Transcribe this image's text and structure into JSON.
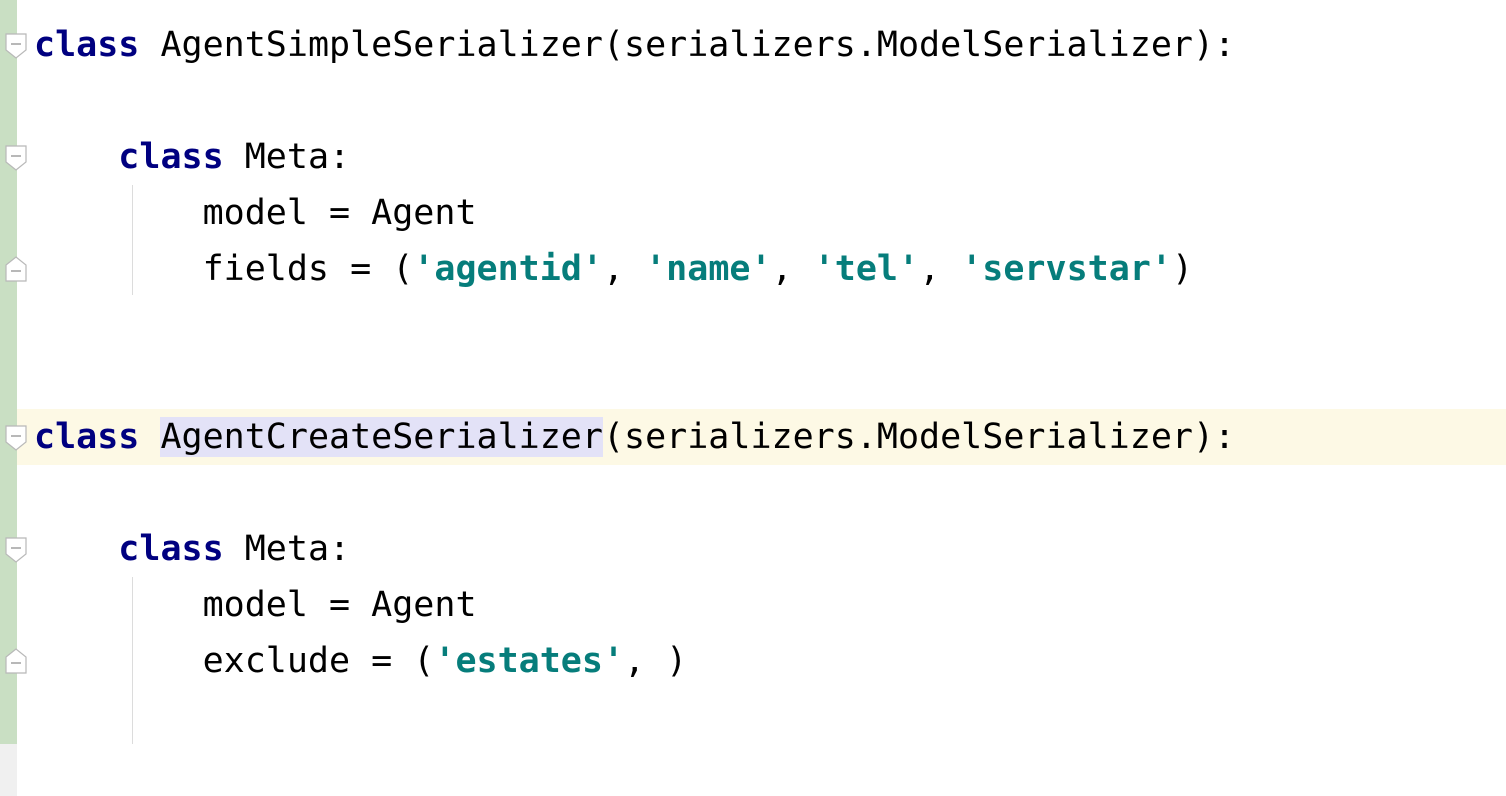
{
  "editor": {
    "colors": {
      "keyword": "#000080",
      "string": "#067d7b",
      "identifier_highlight": "#e3e2f7",
      "current_line": "#fdf9e5",
      "gutter_vcs_added": "#c9dfc3"
    },
    "lines": {
      "l1": {
        "kw": "class",
        "name": "AgentSimpleSerializer",
        "rest": "(serializers.ModelSerializer):"
      },
      "l2": {
        "kw": "class",
        "rest": "Meta:"
      },
      "l3": {
        "text": "model = Agent"
      },
      "l4": {
        "pre": "fields = (",
        "s1": "'agentid'",
        "c1": ", ",
        "s2": "'name'",
        "c2": ", ",
        "s3": "'tel'",
        "c3": ", ",
        "s4": "'servstar'",
        "post": ")"
      },
      "l5": {
        "kw": "class",
        "name": "AgentCreateSerializer",
        "rest": "(serializers.ModelSerializer):"
      },
      "l6": {
        "kw": "class",
        "rest": "Meta:"
      },
      "l7": {
        "text": "model = Agent"
      },
      "l8": {
        "pre": "exclude = (",
        "s1": "'estates'",
        "post": ", )"
      }
    },
    "fold_markers": [
      "fold-open-icon",
      "fold-open-icon",
      "fold-close-icon",
      "fold-open-icon",
      "fold-open-icon",
      "fold-close-icon"
    ]
  }
}
